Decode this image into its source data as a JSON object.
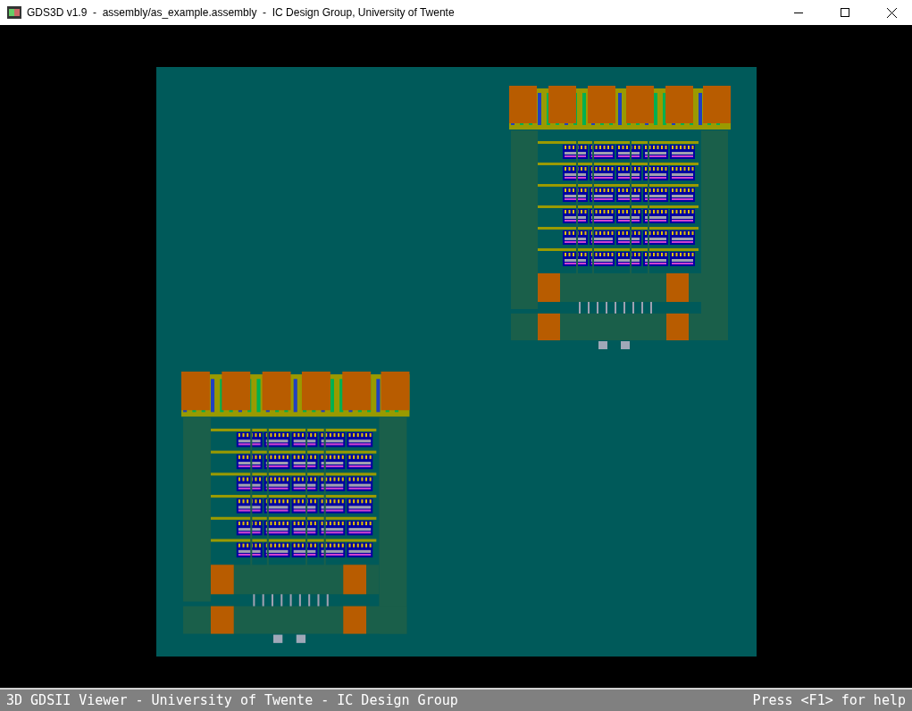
{
  "window": {
    "title": "GDS3D v1.9  -  assembly/as_example.assembly  -  IC Design Group, University of Twente"
  },
  "status_bar": {
    "left": "3D GDSII Viewer - University of Twente - IC Design Group",
    "right": "Press <F1> for help"
  }
}
